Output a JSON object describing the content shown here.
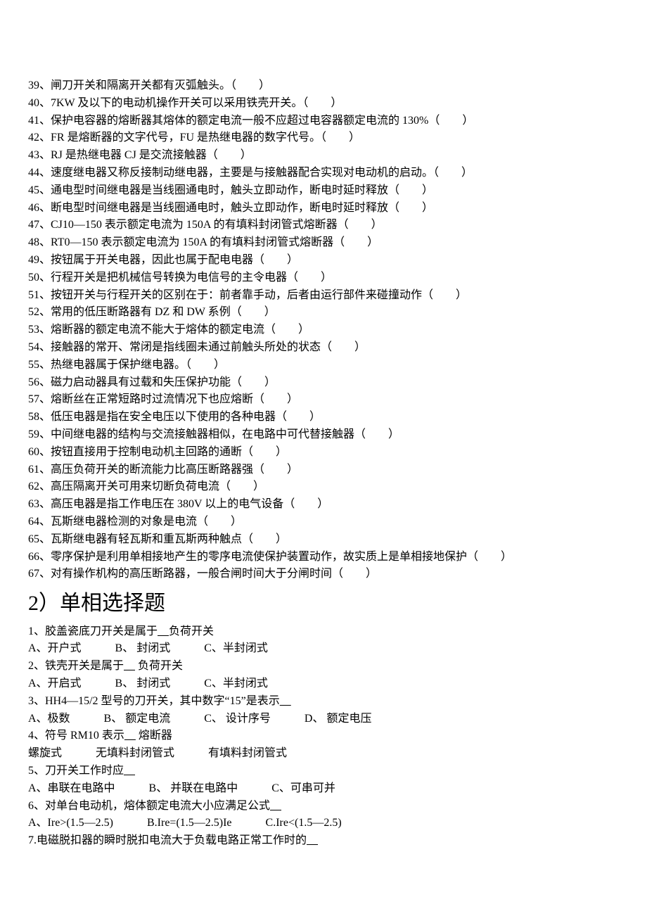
{
  "trueFalse": [
    "39、闸刀开关和隔离开关都有灭弧触头。（　　）",
    "40、7KW 及以下的电动机操作开关可以采用铁壳开关。（　　）",
    "41、保护电容器的熔断器其熔体的额定电流一般不应超过电容器额定电流的 130%（　　）",
    "42、FR 是熔断器的文字代号，FU 是热继电器的数字代号。（　　）",
    "43、RJ 是热继电器 CJ 是交流接触器（　　）",
    "44、速度继电器又称反接制动继电器，主要是与接触器配合实现对电动机的启动。（　　）",
    "45、通电型时间继电器是当线圈通电时，触头立即动作，断电时延时释放（　　）",
    "46、断电型时间继电器是当线圈通电时，触头立即动作，断电时延时释放（　　）",
    "47、CJ10—150 表示额定电流为 150A 的有填料封闭管式熔断器（　　）",
    "48、RT0—150 表示额定电流为 150A 的有填料封闭管式熔断器（　　）",
    "49、按钮属于开关电器，因此也属于配电电器（　　）",
    "50、行程开关是把机械信号转换为电信号的主令电器（　　）",
    "51、按钮开关与行程开关的区别在于：前者靠手动，后者由运行部件来碰撞动作（　　）",
    "52、常用的低压断路器有 DZ 和 DW 系例（　　）",
    "53、熔断器的额定电流不能大于熔体的额定电流（　　）",
    "54、接触器的常开、常闭是指线圈未通过前触头所处的状态（　　）",
    "55、热继电器属于保护继电器。（　　）",
    "56、磁力启动器具有过载和失压保护功能（　　）",
    "57、熔断丝在正常短路时过流情况下也应熔断（　　）",
    "58、低压电器是指在安全电压以下使用的各种电器（　　）",
    "59、中间继电器的结构与交流接触器相似，在电路中可代替接触器（　　）",
    "60、按钮直接用于控制电动机主回路的通断（　　）",
    "61、高压负荷开关的断流能力比高压断路器强（　　）",
    "62、高压隔离开关可用来切断负荷电流（　　）",
    "63、高压电器是指工作电压在 380V 以上的电气设备（　　）",
    "64、瓦斯继电器检测的对象是电流（　　）",
    "65、瓦斯继电器有轻瓦斯和重瓦斯两种触点（　　）",
    "66、零序保护是利用单相接地产生的零序电流使保护装置动作，故实质上是单相接地保护（　　）",
    "67、对有操作机构的高压断路器，一般合闸时间大于分闸时间（　　）"
  ],
  "sectionHeading": "2）单相选择题",
  "mc": [
    {
      "stem": "1、胶盖瓷底刀开关是属于___负荷开关",
      "options": "A、开户式　　　B、 封闭式　　　C、半封闭式"
    },
    {
      "stem": "2、铁壳开关是属于___ 负荷开关",
      "options": "A、开启式　　　B、 封闭式　　　C、半封闭式"
    },
    {
      "stem": "3、HH4—15/2 型号的刀开关，其中数字“15”是表示___",
      "options": "A、极数　　　B、 额定电流　　　C、 设计序号　　　D、 额定电压"
    },
    {
      "stem": "4、符号 RM10 表示___ 熔断器",
      "options": "螺旋式　　　无填料封闭管式　　　有填料封闭管式"
    },
    {
      "stem": "5、刀开关工作时应___",
      "options": "A、串联在电路中　　　B、 并联在电路中　　　C、可串可并"
    },
    {
      "stem": "6、对单台电动机，熔体额定电流大小应满足公式___",
      "options": "A、Ire>(1.5—2.5)　　　B.Ire=(1.5—2.5)Ie　　　C.Ire<(1.5—2.5)"
    },
    {
      "stem": "7.电磁脱扣器的瞬时脱扣电流大于负载电路正常工作时的___",
      "options": ""
    }
  ]
}
